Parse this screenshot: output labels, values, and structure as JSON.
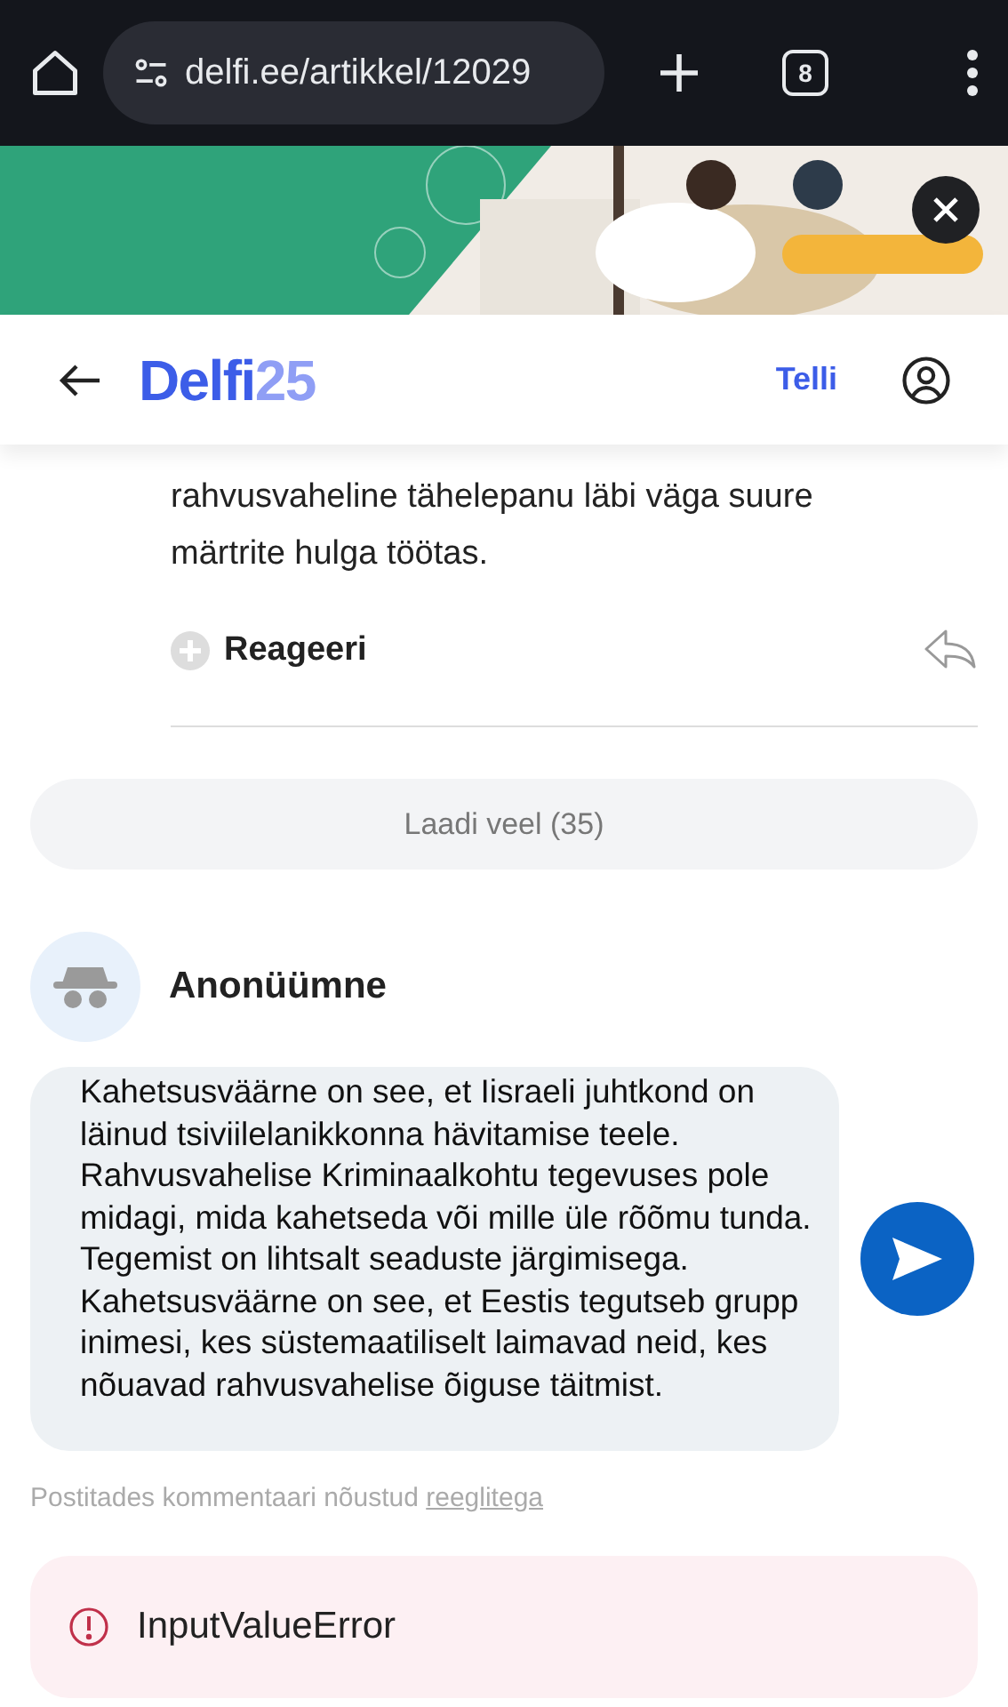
{
  "browser": {
    "url": "delfi.ee/artikkel/12029",
    "tab_count": "8"
  },
  "header": {
    "logo": "Delfi",
    "logo_number": "25",
    "subscribe": "Telli"
  },
  "comment": {
    "text_lines": [
      "rahvusvaheline tähelepanu läbi väga suure",
      "märtrite hulga töötas."
    ],
    "react": "Reageeri"
  },
  "load_more": "Laadi veel (35)",
  "composer": {
    "author": "Anonüümne",
    "value": "Kahetsusväärne on see, et Iisraeli juhtkond on läinud tsiviilelanikkonna hävitamise teele. Rahvusvahelise Kriminaalkohtu tegevuses pole midagi, mida kahetseda või mille üle rõõmu tunda. Tegemist on lihtsalt seaduste järgimisega. Kahetsusväärne on see, et Eestis tegutseb grupp inimesi, kes süstemaatiliselt laimavad neid, kes nõuavad rahvusvahelise õiguse täitmist.",
    "terms": "Postitades kommentaari nõustud",
    "terms_link": "reeglitega"
  },
  "error": {
    "message": "InputValueError"
  }
}
